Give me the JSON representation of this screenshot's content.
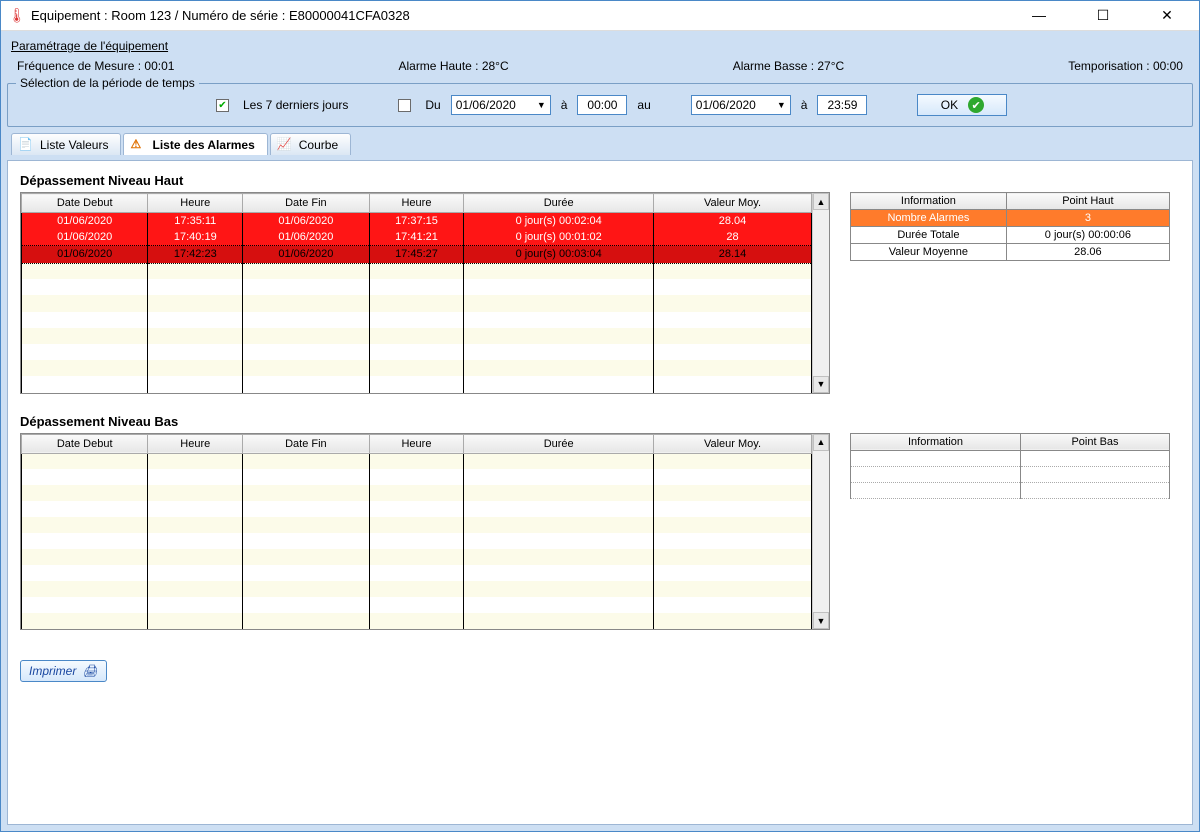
{
  "window": {
    "title": "Equipement : Room 123 / Numéro de série : E80000041CFA0328"
  },
  "params": {
    "link": "Paramétrage de l'équipement",
    "freq_label": "Fréquence de Mesure : 00:01",
    "alarm_high_label": "Alarme Haute : 28°C",
    "alarm_low_label": "Alarme Basse : 27°C",
    "tempo_label": "Temporisation : 00:00"
  },
  "period": {
    "legend": "Sélection de la période de temps",
    "last7_label": "Les 7 derniers jours",
    "last7_checked": true,
    "du_label": "Du",
    "du_checked": false,
    "date_from": "01/06/2020",
    "a1": "à",
    "time_from": "00:00",
    "au": "au",
    "date_to": "01/06/2020",
    "a2": "à",
    "time_to": "23:59",
    "ok_label": "OK"
  },
  "tabs": {
    "t1": "Liste Valeurs",
    "t2": "Liste des Alarmes",
    "t3": "Courbe"
  },
  "high": {
    "title": "Dépassement Niveau Haut",
    "headers": {
      "c1": "Date Debut",
      "c2": "Heure",
      "c3": "Date Fin",
      "c4": "Heure",
      "c5": "Durée",
      "c6": "Valeur Moy."
    },
    "rows": [
      {
        "d1": "01/06/2020",
        "h1": "17:35:11",
        "d2": "01/06/2020",
        "h2": "17:37:15",
        "dur": "0 jour(s) 00:02:04",
        "val": "28.04"
      },
      {
        "d1": "01/06/2020",
        "h1": "17:40:19",
        "d2": "01/06/2020",
        "h2": "17:41:21",
        "dur": "0 jour(s) 00:01:02",
        "val": "28"
      },
      {
        "d1": "01/06/2020",
        "h1": "17:42:23",
        "d2": "01/06/2020",
        "h2": "17:45:27",
        "dur": "0 jour(s) 00:03:04",
        "val": "28.14"
      }
    ],
    "side": {
      "h1": "Information",
      "h2": "Point Haut",
      "r1a": "Nombre Alarmes",
      "r1b": "3",
      "r2a": "Durée Totale",
      "r2b": "0 jour(s) 00:00:06",
      "r3a": "Valeur Moyenne",
      "r3b": "28.06"
    }
  },
  "low": {
    "title": "Dépassement Niveau Bas",
    "headers": {
      "c1": "Date Debut",
      "c2": "Heure",
      "c3": "Date Fin",
      "c4": "Heure",
      "c5": "Durée",
      "c6": "Valeur Moy."
    },
    "side": {
      "h1": "Information",
      "h2": "Point Bas"
    }
  },
  "print": {
    "label": "Imprimer"
  }
}
